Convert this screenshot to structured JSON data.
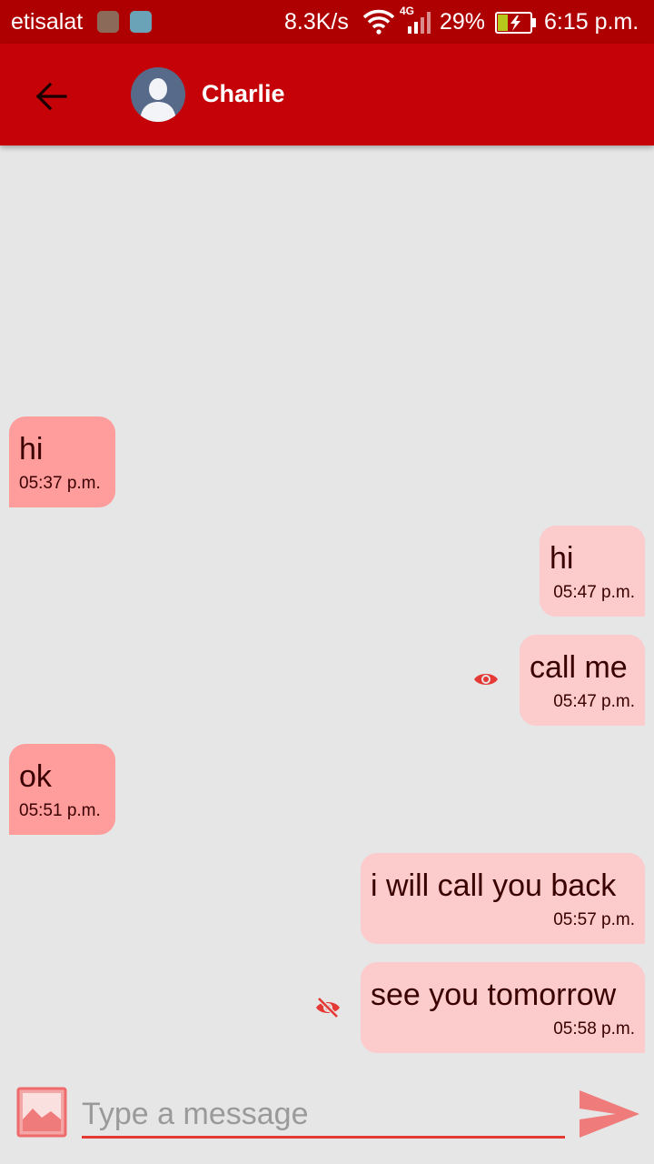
{
  "status_bar": {
    "carrier": "etisalat",
    "speed": "8.3K/s",
    "network_type": "4G",
    "battery": "29%",
    "time": "6:15 p.m."
  },
  "app_bar": {
    "contact_name": "Charlie"
  },
  "messages": [
    {
      "direction": "incoming",
      "text": "hi",
      "time": "05:37 p.m."
    },
    {
      "direction": "outgoing",
      "text": "hi",
      "time": "05:47 p.m."
    },
    {
      "direction": "outgoing",
      "text": "call me",
      "time": "05:47 p.m.",
      "status_icon": "eye-icon"
    },
    {
      "direction": "incoming",
      "text": "ok",
      "time": "05:51 p.m."
    },
    {
      "direction": "outgoing",
      "text": "i will call you back",
      "time": "05:57 p.m."
    },
    {
      "direction": "outgoing",
      "text": "see you tomorrow",
      "time": "05:58 p.m.",
      "status_icon": "eye-off-icon"
    }
  ],
  "compose": {
    "placeholder": "Type a message"
  },
  "colors": {
    "status_bar": "#ae0000",
    "app_bar": "#c40207",
    "incoming_bubble": "#ff9c9c",
    "outgoing_bubble": "#fccbcb",
    "accent": "#e53935"
  }
}
